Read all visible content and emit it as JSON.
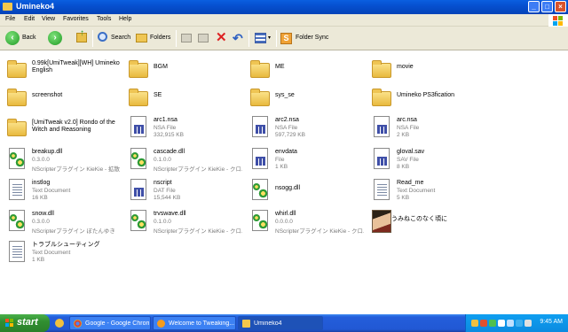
{
  "window": {
    "title": "Umineko4"
  },
  "menu": [
    "File",
    "Edit",
    "View",
    "Favorites",
    "Tools",
    "Help"
  ],
  "toolbar": {
    "back": "Back",
    "search": "Search",
    "folders": "Folders",
    "folder_sync": "Folder Sync"
  },
  "files": [
    {
      "kind": "folder",
      "name": "0.99k[UmiTweak][WH] Umineko English"
    },
    {
      "kind": "folder",
      "name": "BGM"
    },
    {
      "kind": "folder",
      "name": "ME"
    },
    {
      "kind": "folder",
      "name": "movie"
    },
    {
      "kind": "folder",
      "name": "screenshot"
    },
    {
      "kind": "folder",
      "name": "SE"
    },
    {
      "kind": "folder",
      "name": "sys_se"
    },
    {
      "kind": "folder",
      "name": "Umineko PS3fication"
    },
    {
      "kind": "folder",
      "name": "[UmiTweak v2.0]  Rondo of the Witch and Reasoning"
    },
    {
      "kind": "nsa",
      "name": "arc1.nsa",
      "type": "NSA File",
      "size": "332,915 KB"
    },
    {
      "kind": "nsa",
      "name": "arc2.nsa",
      "type": "NSA File",
      "size": "597,729 KB"
    },
    {
      "kind": "nsa",
      "name": "arc.nsa",
      "type": "NSA File",
      "size": "2 KB"
    },
    {
      "kind": "dll",
      "name": "breakup.dll",
      "type": "0.3.0.0",
      "size": "NScripterプラグイン KieKie - 拡散"
    },
    {
      "kind": "dll",
      "name": "cascade.dll",
      "type": "0.1.0.0",
      "size": "NScripterプラグイン KieKie - クロ..."
    },
    {
      "kind": "nsa",
      "name": "envdata",
      "type": "File",
      "size": "1 KB"
    },
    {
      "kind": "nsa",
      "name": "gloval.sav",
      "type": "SAV File",
      "size": "8 KB"
    },
    {
      "kind": "text",
      "name": "instlog",
      "type": "Text Document",
      "size": "16 KB"
    },
    {
      "kind": "nsa",
      "name": "nscript",
      "type": "DAT File",
      "size": "15,544 KB"
    },
    {
      "kind": "dll",
      "name": "nsogg.dll",
      "type": "",
      "size": ""
    },
    {
      "kind": "text",
      "name": "Read_me",
      "type": "Text Document",
      "size": "5 KB"
    },
    {
      "kind": "dll",
      "name": "snow.dll",
      "type": "0.3.0.0",
      "size": "NScripterプラグイン ぼたんゆき"
    },
    {
      "kind": "dll",
      "name": "trvswave.dll",
      "type": "0.1.0.0",
      "size": "NScripterプラグイン KieKie - クロ..."
    },
    {
      "kind": "dll",
      "name": "whirl.dll",
      "type": "0.0.0.0",
      "size": "NScripterプラグイン KieKie - クロ..."
    },
    {
      "kind": "image",
      "name": "うみねこのなく頃に",
      "type": "",
      "size": ""
    },
    {
      "kind": "text",
      "name": "トラブルシューティング",
      "type": "Text Document",
      "size": "1 KB"
    }
  ],
  "taskbar": {
    "start": "start",
    "tasks": [
      "Google - Google Chrome",
      "Welcome to Tweaking...",
      "Umineko4"
    ],
    "clock": "9:45 AM"
  }
}
